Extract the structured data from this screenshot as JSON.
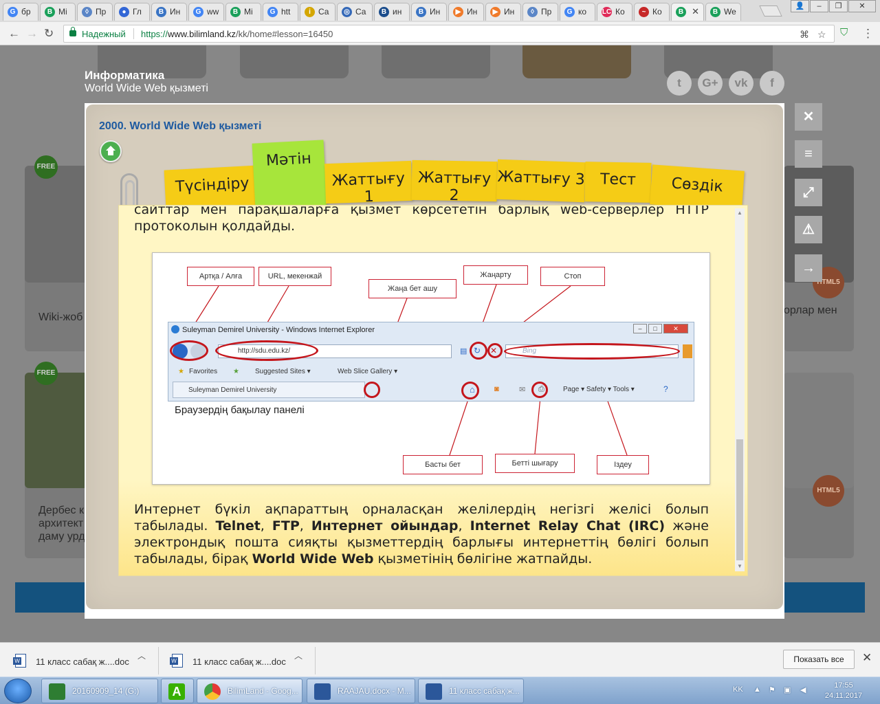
{
  "browser": {
    "tabs": [
      {
        "label": "бр",
        "icon": "google-icon",
        "color": "#4285f4",
        "glyph": "G"
      },
      {
        "label": "Mi",
        "icon": "bilimland-icon",
        "color": "#1aa05a",
        "glyph": "B"
      },
      {
        "label": "Пр",
        "icon": "diamond-icon",
        "color": "#5b86c7",
        "glyph": "◊"
      },
      {
        "label": "Гл",
        "icon": "chrome-icon",
        "color": "#3367d6",
        "glyph": "●"
      },
      {
        "label": "Ин",
        "icon": "b-icon",
        "color": "#3a74c4",
        "glyph": "B"
      },
      {
        "label": "ww",
        "icon": "google-icon",
        "color": "#4285f4",
        "glyph": "G"
      },
      {
        "label": "Mi",
        "icon": "bilimland-icon",
        "color": "#1aa05a",
        "glyph": "B"
      },
      {
        "label": "htt",
        "icon": "google-icon",
        "color": "#4285f4",
        "glyph": "G"
      },
      {
        "label": "Са",
        "icon": "info-icon",
        "color": "#d4a600",
        "glyph": "i"
      },
      {
        "label": "Са",
        "icon": "globe-icon",
        "color": "#3569b8",
        "glyph": "◎"
      },
      {
        "label": "ин",
        "icon": "b-icon",
        "color": "#1b4d8c",
        "glyph": "B"
      },
      {
        "label": "Ин",
        "icon": "b-icon",
        "color": "#3a74c4",
        "glyph": "B"
      },
      {
        "label": "Ин",
        "icon": "play-icon",
        "color": "#f07a2a",
        "glyph": "▶"
      },
      {
        "label": "Ин",
        "icon": "play-icon",
        "color": "#f07a2a",
        "glyph": "▶"
      },
      {
        "label": "Пр",
        "icon": "diamond-icon",
        "color": "#5b86c7",
        "glyph": "◊"
      },
      {
        "label": "ко",
        "icon": "google-icon",
        "color": "#4285f4",
        "glyph": "G"
      },
      {
        "label": "Ко",
        "icon": "lc-icon",
        "color": "#e02a58",
        "glyph": "LC"
      },
      {
        "label": "Ко",
        "icon": "dash-icon",
        "color": "#c62828",
        "glyph": "~"
      },
      {
        "label": "",
        "icon": "bilimland-icon",
        "color": "#1aa05a",
        "glyph": "B"
      },
      {
        "label": "We",
        "icon": "bilimland-icon",
        "color": "#1aa05a",
        "glyph": "B"
      }
    ],
    "address": {
      "secure_label": "Надежный",
      "scheme": "https://",
      "host": "www.bilimland.kz",
      "path": "/kk/home#lesson=16450"
    }
  },
  "page": {
    "subject": "Информатика",
    "lesson_subtitle": "World Wide Web қызметі",
    "social": [
      {
        "icon": "twitter-icon",
        "glyph": "t"
      },
      {
        "icon": "googleplus-icon",
        "glyph": "G+"
      },
      {
        "icon": "vk-icon",
        "glyph": "vk"
      },
      {
        "icon": "facebook-icon",
        "glyph": "f"
      }
    ],
    "bg_cards": {
      "free_label": "FREE",
      "card1_text": "Wiki-жоб",
      "card2_text": "орлар мен",
      "card3_lines": [
        "Дербес к",
        "архитект",
        "даму урд"
      ],
      "html5_label": "HTML5"
    }
  },
  "modal": {
    "title": "2000. World Wide Web қызметі",
    "tabs": [
      "Түсіндіру",
      "Мәтін",
      "Жаттығу 1",
      "Жаттығу 2",
      "Жаттығу 3",
      "Тест",
      "Сөздік"
    ],
    "active_tab": "Мәтін",
    "paragraph_top": "сайттар мен парақшаларға қызмет көрсететін барлық web-серверлер HTTP протоколын қолдайды.",
    "figure": {
      "labels": {
        "back_forward": "Артқа / Алға",
        "url": "URL, мекенжай",
        "new_tab": "Жаңа бет ашу",
        "refresh": "Жаңарту",
        "stop": "Стоп",
        "home": "Басты бет",
        "print": "Бетті шығару",
        "search": "Іздеу"
      },
      "ie": {
        "title": "Suleyman Demirel University - Windows Internet Explorer",
        "url": "http://sdu.edu.kz/",
        "search_placeholder": "Bing",
        "favorites": "Favorites",
        "suggested": "Suggested Sites ▾",
        "webslice": "Web Slice Gallery ▾",
        "tab_title": "Suleyman Demirel University",
        "tools": "Page ▾   Safety ▾   Tools ▾"
      },
      "caption": "Браузердің бақылау панелі"
    },
    "paragraph_bottom": {
      "part1": "Интернет бүкіл ақпараттың орналасқан желілердің негізгі желісі болып табылады. ",
      "telnet": "Telnet",
      "comma1": ", ",
      "ftp": "FTP",
      "comma2": ",  ",
      "games": "Интернет ойындар",
      "comma3": ", ",
      "irc": "Internet Relay Chat (IRC)",
      "part2": " және электрондық пошта сияқты қызметтердің барлығы интернеттің бөлігі болып табылады, бірақ ",
      "www": "World Wide Web",
      "part3": " қызметінің бөлігіне жатпайды."
    },
    "side_tools": [
      {
        "icon": "close-icon",
        "glyph": "✕"
      },
      {
        "icon": "menu-icon",
        "glyph": "≡"
      },
      {
        "icon": "fullscreen-icon",
        "glyph": "⤢"
      },
      {
        "icon": "warning-icon",
        "glyph": "⚠"
      },
      {
        "icon": "arrow-right-icon",
        "glyph": "→"
      }
    ]
  },
  "downloads": {
    "items": [
      "11 класс сабақ ж....doc",
      "11 класс сабақ ж....doc"
    ],
    "show_all": "Показать все"
  },
  "taskbar": {
    "items": [
      {
        "label": "20160909_14 (G:)",
        "color": "#2e7d32"
      },
      {
        "label": "",
        "color": "#38b000",
        "glyph": "A"
      },
      {
        "label": "BilimLand - Goog...",
        "color": "#e53935"
      },
      {
        "label": "RAAJAU.docx - M...",
        "color": "#2b579a"
      },
      {
        "label": "11 класс сабақ ж...",
        "color": "#2b579a"
      }
    ],
    "lang": "KK",
    "time": "17:55",
    "date": "24.11.2017"
  }
}
